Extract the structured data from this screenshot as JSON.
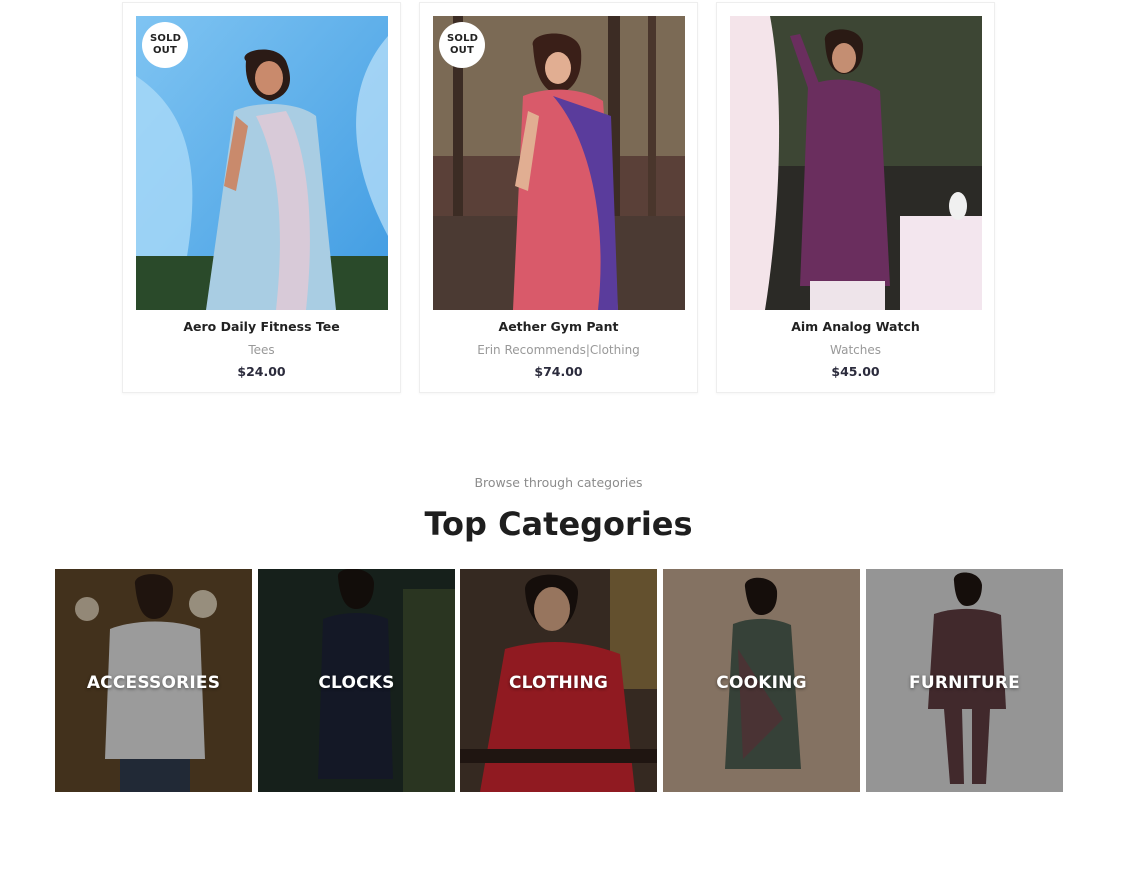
{
  "products": [
    {
      "name": "Aero Daily Fitness Tee",
      "category": "Tees",
      "price": "$24.00",
      "badge": "SOLD OUT"
    },
    {
      "name": "Aether Gym Pant",
      "category": "Erin Recommends|Clothing",
      "price": "$74.00",
      "badge": "SOLD OUT"
    },
    {
      "name": "Aim Analog Watch",
      "category": "Watches",
      "price": "$45.00",
      "badge": ""
    }
  ],
  "section": {
    "subtitle": "Browse through categories",
    "title": "Top Categories"
  },
  "categories": [
    {
      "label": "ACCESSORIES"
    },
    {
      "label": "CLOCKS"
    },
    {
      "label": "CLOTHING"
    },
    {
      "label": "COOKING"
    },
    {
      "label": "FURNITURE"
    }
  ]
}
